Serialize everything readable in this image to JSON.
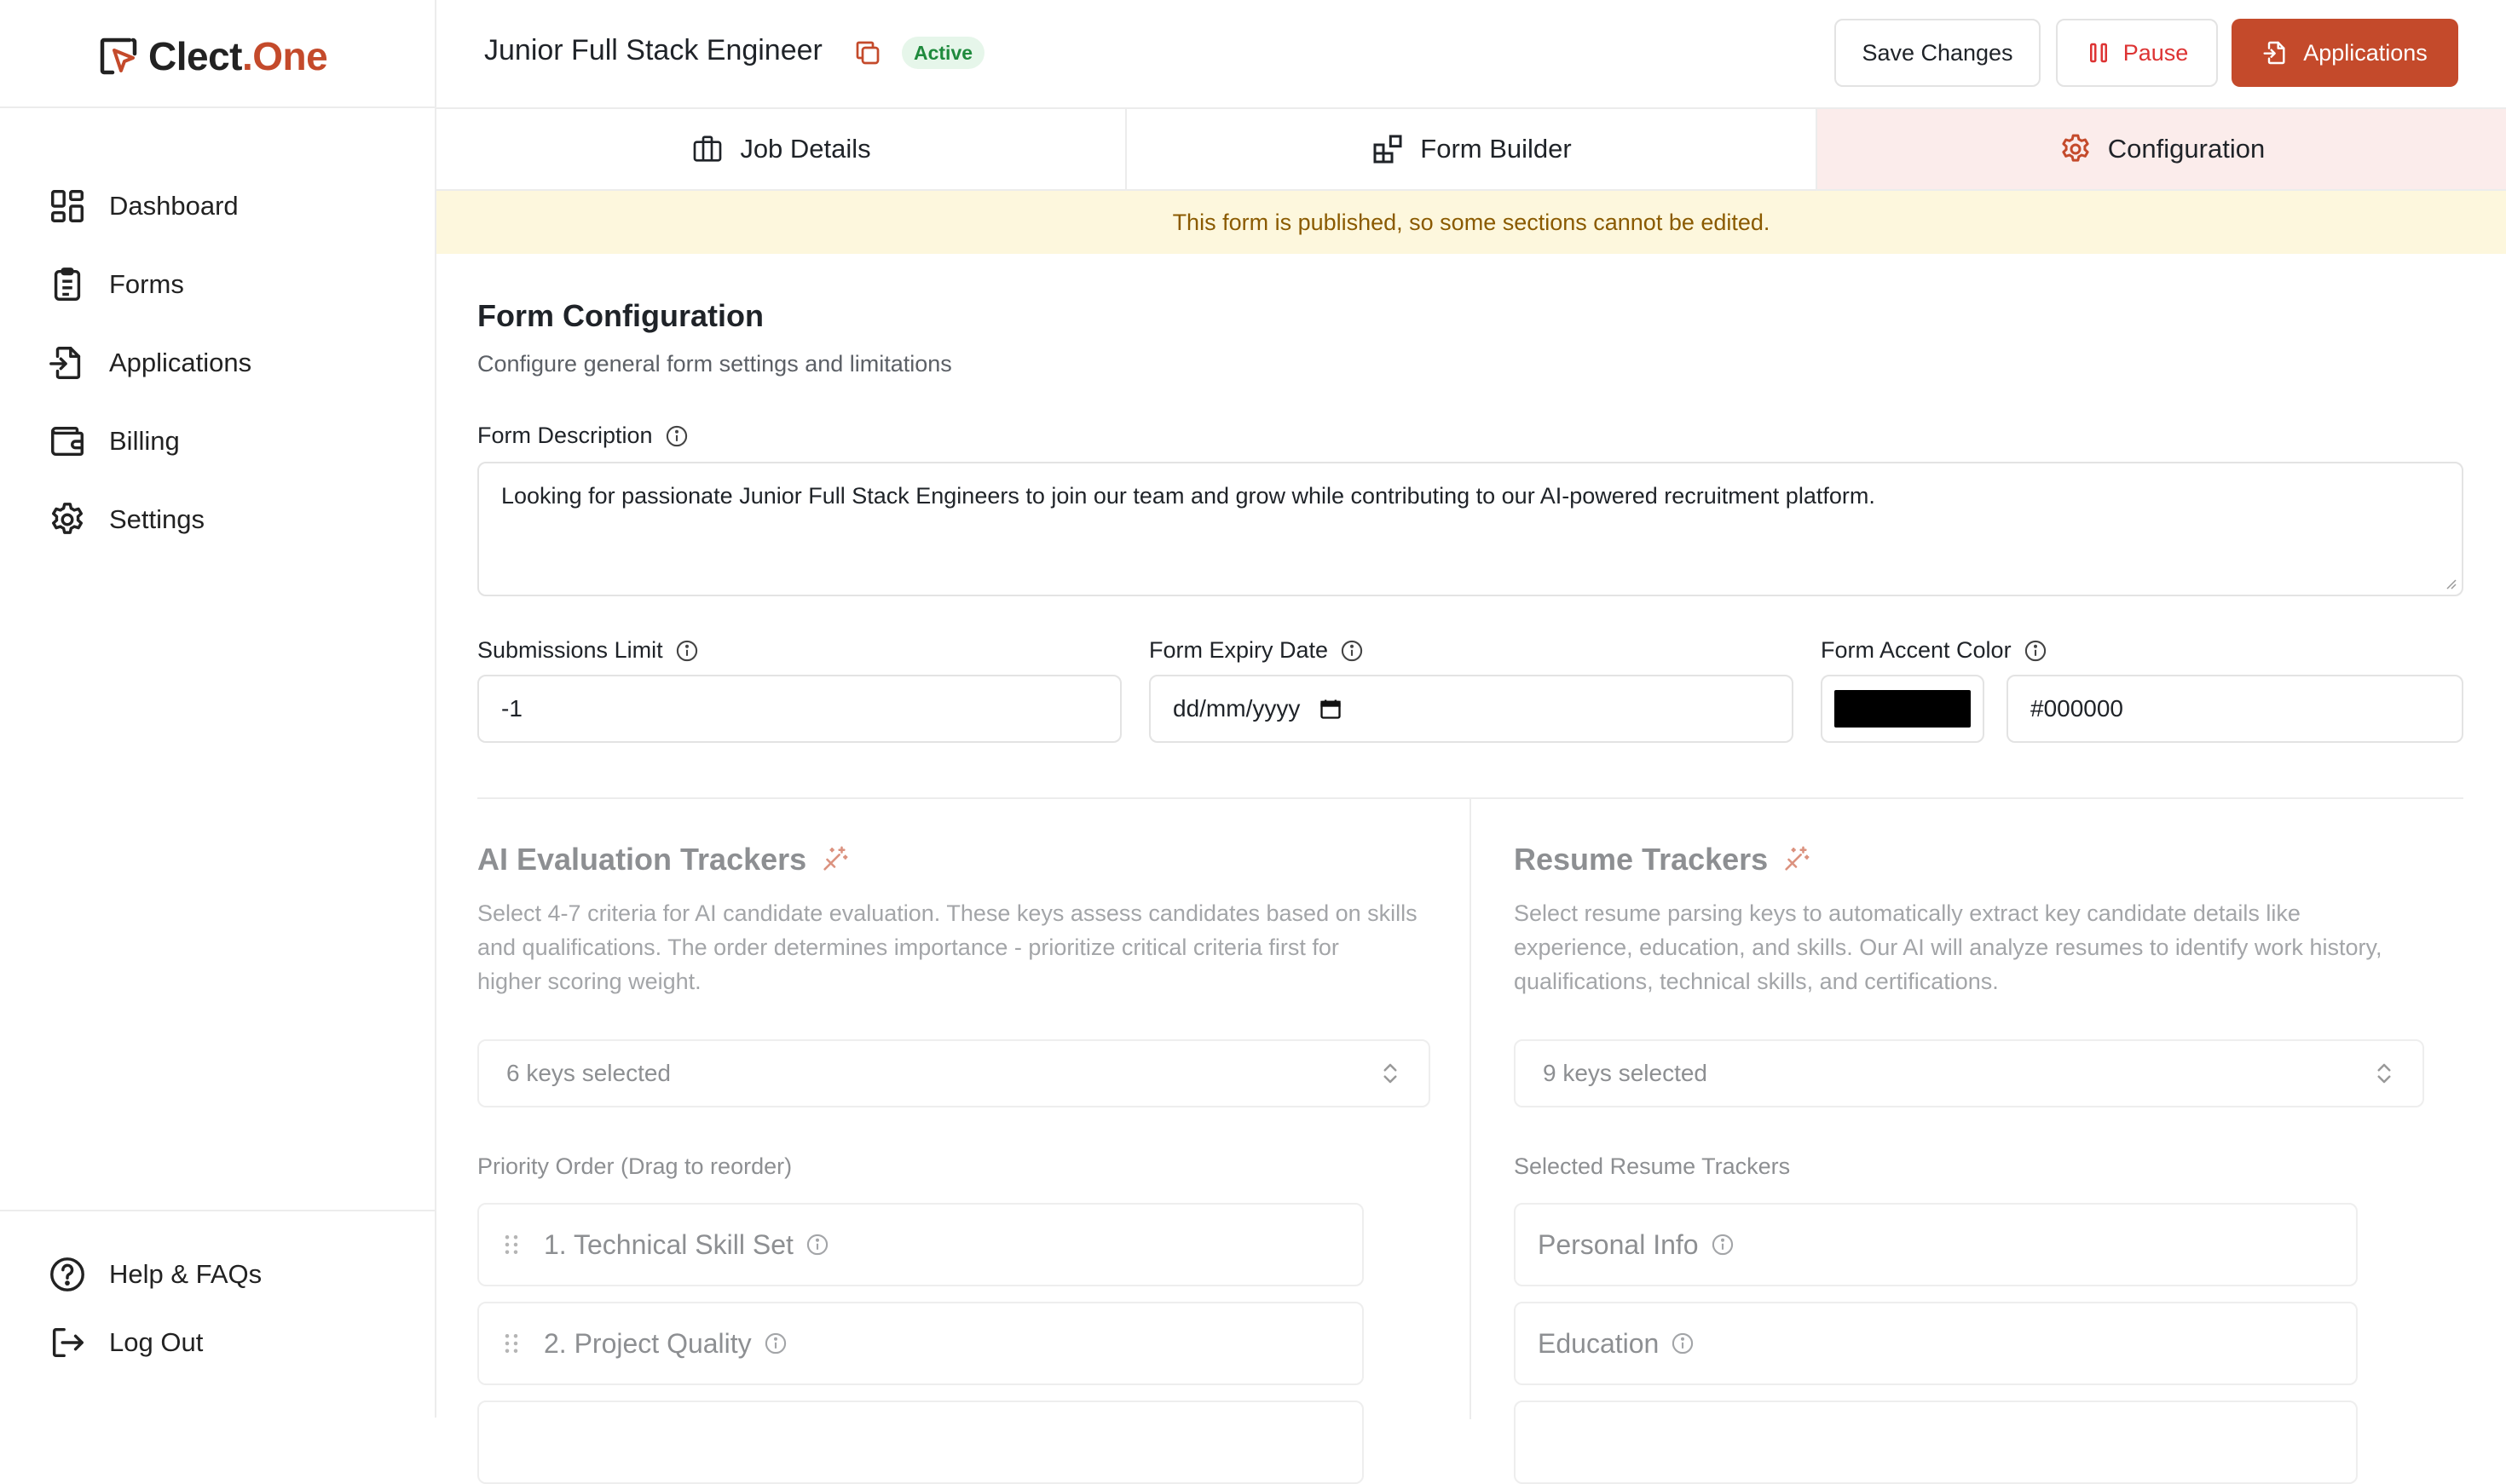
{
  "brand": {
    "name_part1": "Clect",
    "dot": ".",
    "name_part2": "One",
    "accent": "#c44a2b"
  },
  "sidebar": {
    "items": [
      {
        "label": "Dashboard",
        "icon": "dashboard-icon"
      },
      {
        "label": "Forms",
        "icon": "clipboard-icon"
      },
      {
        "label": "Applications",
        "icon": "file-import-icon"
      },
      {
        "label": "Billing",
        "icon": "wallet-icon"
      },
      {
        "label": "Settings",
        "icon": "gear-icon"
      }
    ],
    "bottom": [
      {
        "label": "Help & FAQs",
        "icon": "help-circle-icon"
      },
      {
        "label": "Log Out",
        "icon": "logout-icon"
      }
    ]
  },
  "header": {
    "title": "Junior Full Stack Engineer",
    "status": "Active",
    "save_label": "Save Changes",
    "pause_label": "Pause",
    "applications_label": "Applications"
  },
  "tabs": [
    {
      "label": "Job Details",
      "icon": "briefcase-icon"
    },
    {
      "label": "Form Builder",
      "icon": "widgets-icon"
    },
    {
      "label": "Configuration",
      "icon": "gear-icon",
      "active": true
    }
  ],
  "banner": "This form is published, so some sections cannot be edited.",
  "config": {
    "title": "Form Configuration",
    "subtitle": "Configure general form settings and limitations",
    "description_label": "Form Description",
    "description_value": "Looking for passionate Junior Full Stack Engineers to join our team and grow while contributing to our AI-powered recruitment platform.",
    "submissions_label": "Submissions Limit",
    "submissions_value": "-1",
    "expiry_label": "Form Expiry Date",
    "expiry_placeholder": "dd/mm/yyyy",
    "accent_label": "Form Accent Color",
    "accent_value": "#000000"
  },
  "ai_trackers": {
    "title": "AI Evaluation Trackers",
    "desc_line1": "Select 4-7 criteria for AI candidate evaluation. These keys assess candidates based on skills",
    "desc_line2": "and qualifications. The order determines importance - prioritize critical criteria first for",
    "desc_line3": "higher scoring weight.",
    "selected": "6 keys selected",
    "list_label": "Priority Order (Drag to reorder)",
    "items": [
      "1. Technical Skill Set",
      "2. Project Quality"
    ]
  },
  "resume_trackers": {
    "title": "Resume Trackers",
    "desc_line1": "Select resume parsing keys to automatically extract key candidate details like",
    "desc_line2": "experience, education, and skills. Our AI will analyze resumes to identify work history,",
    "desc_line3": "qualifications, technical skills, and certifications.",
    "selected": "9 keys selected",
    "list_label": "Selected Resume Trackers",
    "items": [
      "Personal Info",
      "Education"
    ]
  }
}
